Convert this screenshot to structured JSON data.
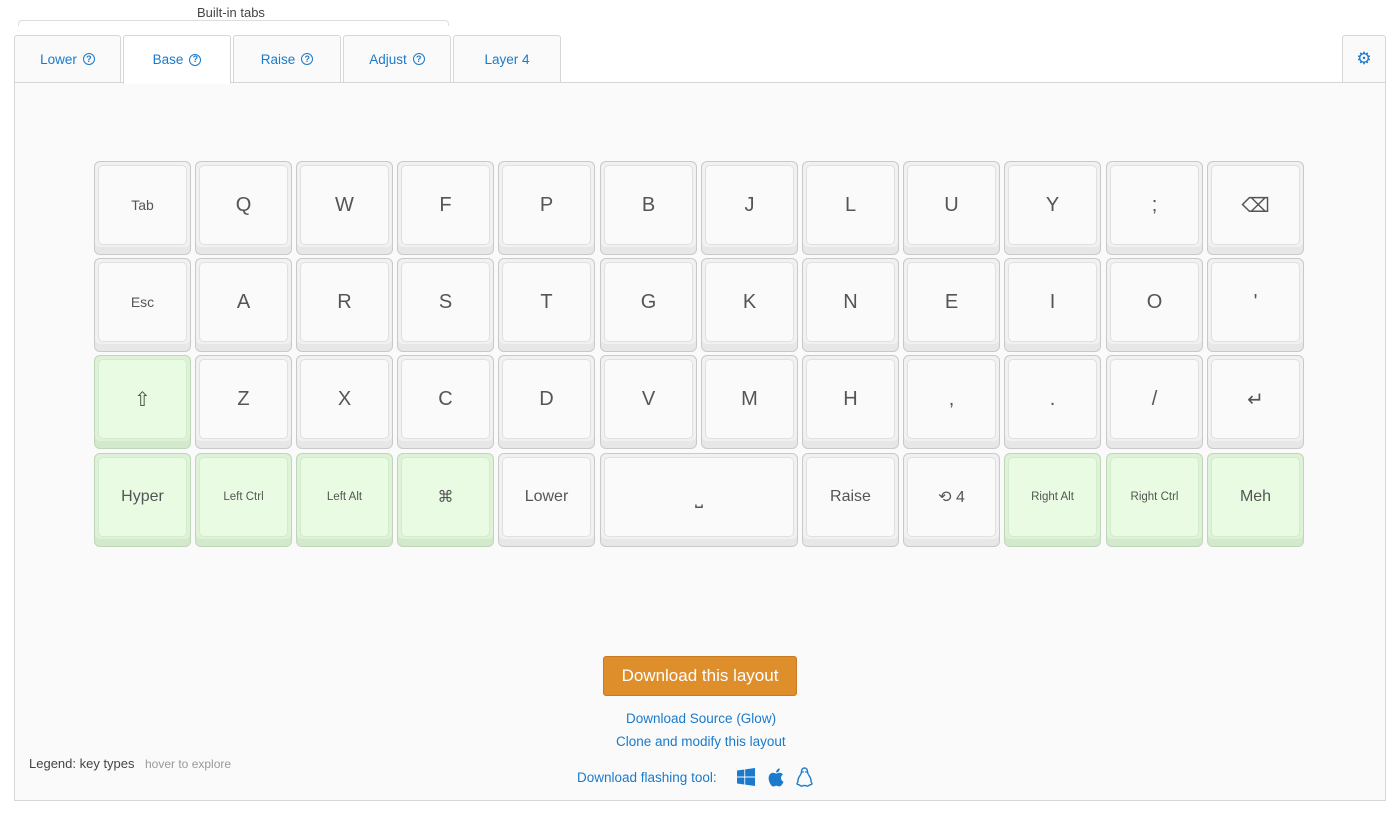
{
  "header": {
    "builtin_tabs_label": "Built-in tabs"
  },
  "tabs": [
    {
      "label": "Lower",
      "help": "?",
      "active": false
    },
    {
      "label": "Base",
      "help": "?",
      "active": true
    },
    {
      "label": "Raise",
      "help": "?",
      "active": false
    },
    {
      "label": "Adjust",
      "help": "?",
      "active": false
    },
    {
      "label": "Layer 4",
      "help": "",
      "active": false
    }
  ],
  "settings": {
    "icon": "gear-icon",
    "glyph": "⚙"
  },
  "colors": {
    "link": "#1a7acb",
    "modifier_key": "#e9fbe2",
    "download_button": "#df8e2c"
  },
  "keyboard": {
    "rows": [
      [
        {
          "label": "Tab",
          "type": "normal",
          "size": "small"
        },
        {
          "label": "Q",
          "type": "normal"
        },
        {
          "label": "W",
          "type": "normal"
        },
        {
          "label": "F",
          "type": "normal"
        },
        {
          "label": "P",
          "type": "normal"
        },
        {
          "label": "B",
          "type": "normal"
        },
        {
          "label": "J",
          "type": "normal"
        },
        {
          "label": "L",
          "type": "normal"
        },
        {
          "label": "U",
          "type": "normal"
        },
        {
          "label": "Y",
          "type": "normal"
        },
        {
          "label": ";",
          "type": "normal"
        },
        {
          "label": "⌫",
          "type": "normal",
          "icon": "backspace-icon"
        }
      ],
      [
        {
          "label": "Esc",
          "type": "normal",
          "size": "small"
        },
        {
          "label": "A",
          "type": "normal"
        },
        {
          "label": "R",
          "type": "normal"
        },
        {
          "label": "S",
          "type": "normal"
        },
        {
          "label": "T",
          "type": "normal"
        },
        {
          "label": "G",
          "type": "normal"
        },
        {
          "label": "K",
          "type": "normal"
        },
        {
          "label": "N",
          "type": "normal"
        },
        {
          "label": "E",
          "type": "normal"
        },
        {
          "label": "I",
          "type": "normal"
        },
        {
          "label": "O",
          "type": "normal"
        },
        {
          "label": "'",
          "type": "normal"
        }
      ],
      [
        {
          "label": "⇧",
          "type": "modifier",
          "icon": "shift-icon"
        },
        {
          "label": "Z",
          "type": "normal"
        },
        {
          "label": "X",
          "type": "normal"
        },
        {
          "label": "C",
          "type": "normal"
        },
        {
          "label": "D",
          "type": "normal"
        },
        {
          "label": "V",
          "type": "normal"
        },
        {
          "label": "M",
          "type": "normal"
        },
        {
          "label": "H",
          "type": "normal"
        },
        {
          "label": ",",
          "type": "normal"
        },
        {
          "label": ".",
          "type": "normal"
        },
        {
          "label": "/",
          "type": "normal"
        },
        {
          "label": "↵",
          "type": "normal",
          "icon": "enter-icon"
        }
      ],
      [
        {
          "label": "Hyper",
          "type": "modifier",
          "size": "mid"
        },
        {
          "label": "Left Ctrl",
          "type": "modifier",
          "size": "tiny"
        },
        {
          "label": "Left Alt",
          "type": "modifier",
          "size": "tiny"
        },
        {
          "label": "⌘",
          "type": "modifier",
          "size": "mid",
          "icon": "command-icon"
        },
        {
          "label": "Lower",
          "type": "normal",
          "size": "mid"
        },
        {
          "label": "⎵",
          "type": "normal",
          "wide": true,
          "icon": "space-icon"
        },
        {
          "label": "Raise",
          "type": "normal",
          "size": "mid"
        },
        {
          "label": "⟲ 4",
          "type": "normal",
          "size": "mid",
          "icon": "layer-toggle-icon"
        },
        {
          "label": "Right Alt",
          "type": "modifier",
          "size": "tiny"
        },
        {
          "label": "Right Ctrl",
          "type": "modifier",
          "size": "tiny"
        },
        {
          "label": "Meh",
          "type": "modifier",
          "size": "mid"
        }
      ]
    ]
  },
  "actions": {
    "download_layout": "Download this layout",
    "download_source": "Download Source (Glow)",
    "clone_modify": "Clone and modify this layout",
    "flashing_tool_label": "Download flashing tool:",
    "os_icons": [
      "windows-icon",
      "apple-icon",
      "linux-icon"
    ]
  },
  "legend": {
    "label": "Legend: key types",
    "hint": "hover to explore"
  }
}
